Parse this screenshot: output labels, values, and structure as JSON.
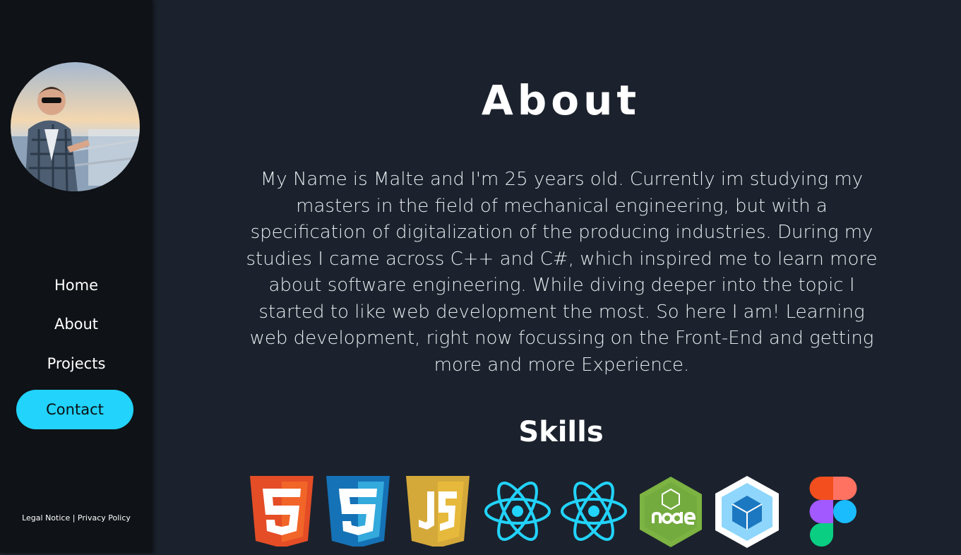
{
  "sidebar": {
    "avatar_alt": "profile photo",
    "nav": [
      {
        "label": "Home"
      },
      {
        "label": "About"
      },
      {
        "label": "Projects"
      }
    ],
    "contact_label": "Contact",
    "legal_notice": "Legal Notice",
    "separator": " | ",
    "privacy_policy": "Privacy Policy"
  },
  "main": {
    "title": "About",
    "bio": "My Name is Malte and I'm 25 years old. Currently im studying my masters in the field of mechanical engineering, but with a specification of digitalization of the producing industries. During my studies I came across C++ and C#, which inspired me to learn more about software engineering. While diving deeper into the topic I started to like web development the most. So here I am! Learning web development, right now focussing on the Front-End and getting more and more Experience.",
    "skills_title": "Skills",
    "skills": [
      {
        "icon": "html5-icon"
      },
      {
        "icon": "css3-icon"
      },
      {
        "icon": "javascript-icon"
      },
      {
        "icon": "react-icon"
      },
      {
        "icon": "react-icon"
      },
      {
        "icon": "nodejs-icon"
      },
      {
        "icon": "webpack-icon"
      },
      {
        "icon": "figma-icon"
      }
    ]
  },
  "colors": {
    "background": "#1b222d",
    "sidebar": "#0f1216",
    "accent": "#22d3fb"
  }
}
